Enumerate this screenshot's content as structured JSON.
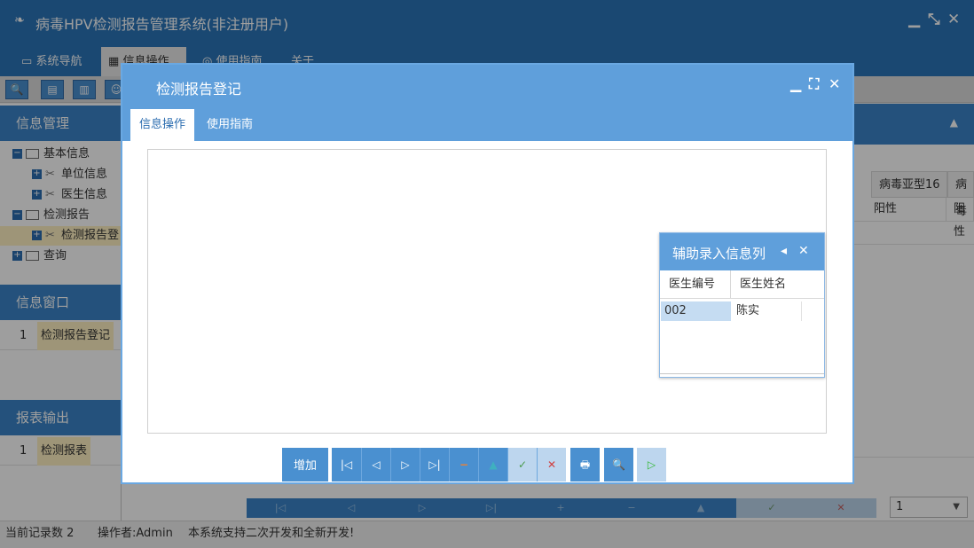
{
  "app": {
    "title": "病毒HPV检测报告管理系统(非注册用户)",
    "menu": [
      {
        "label": "系统导航"
      },
      {
        "label": "信息操作"
      },
      {
        "label": "使用指南"
      },
      {
        "label": "关于"
      }
    ]
  },
  "left_panel": {
    "info_manage_header": "信息管理",
    "tree": [
      {
        "label": "基本信息"
      },
      {
        "label": "单位信息"
      },
      {
        "label": "医生信息"
      },
      {
        "label": "检测报告"
      },
      {
        "label": "检测报告登"
      },
      {
        "label": "查询"
      }
    ],
    "info_window_header": "信息窗口",
    "info_window_items": [
      {
        "num": "1",
        "label": "检测报告登记"
      }
    ],
    "report_output_header": "报表输出",
    "report_output_items": [
      {
        "num": "1",
        "label": "检测报表"
      }
    ]
  },
  "grid": {
    "headers": [
      "病毒亚型16",
      "病毒"
    ],
    "row1": [
      "阳性",
      "阳性"
    ]
  },
  "bg_pager": {
    "page_select": "1"
  },
  "status": {
    "record_count": "当前记录数 2",
    "operator": "操作者:Admin",
    "notice": "本系统支持二次开发和全新开发!"
  },
  "dialog": {
    "title": "检测报告登记",
    "tabs": [
      {
        "label": "信息操作"
      },
      {
        "label": "使用指南"
      }
    ],
    "add_label": "增加"
  },
  "helper": {
    "title": "辅助录入信息列",
    "columns": [
      "医生编号",
      "医生姓名"
    ],
    "rows": [
      {
        "code": "002",
        "name": "陈实"
      }
    ]
  },
  "colors": {
    "title_bar": "#2b75b9",
    "dialog_header": "#5f9fdb",
    "highlight": "#fff1c2",
    "selected_cell": "#c5dcf2"
  }
}
